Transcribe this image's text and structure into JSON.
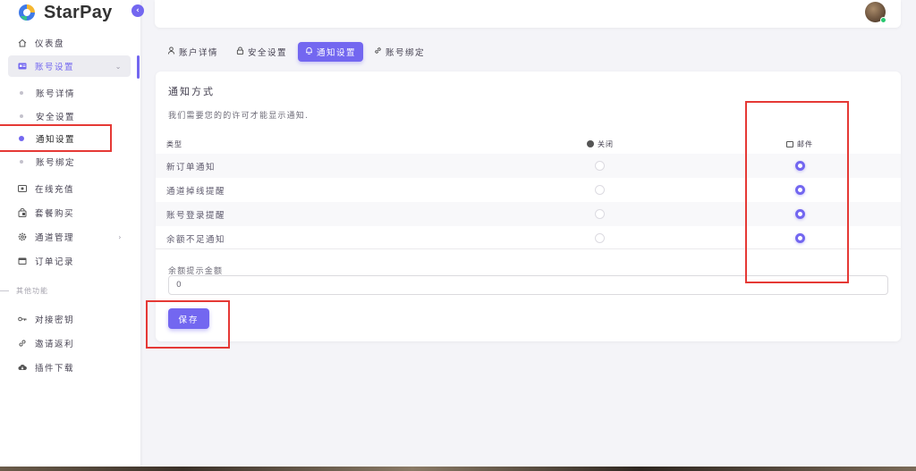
{
  "brand": {
    "name": "StarPay"
  },
  "colors": {
    "accent": "#7367f0",
    "annotation": "#e53935"
  },
  "sidebar": {
    "items": [
      {
        "label": "仪表盘",
        "icon": "home-icon"
      },
      {
        "label": "账号设置",
        "icon": "id-card-icon"
      },
      {
        "label": "在线充值",
        "icon": "wallet-icon"
      },
      {
        "label": "套餐购买",
        "icon": "shopping-bag-icon"
      },
      {
        "label": "通道管理",
        "icon": "gear-icon"
      },
      {
        "label": "订单记录",
        "icon": "calendar-icon"
      }
    ],
    "sub_items": [
      {
        "label": "账号详情"
      },
      {
        "label": "安全设置"
      },
      {
        "label": "通知设置"
      },
      {
        "label": "账号绑定"
      }
    ],
    "section_title": "其他功能",
    "other_items": [
      {
        "label": "对接密钥",
        "icon": "key-icon"
      },
      {
        "label": "邀请返利",
        "icon": "link-icon"
      },
      {
        "label": "插件下载",
        "icon": "cloud-download-icon"
      }
    ]
  },
  "tabs": [
    {
      "label": "账户详情",
      "icon": "user-icon"
    },
    {
      "label": "安全设置",
      "icon": "lock-icon"
    },
    {
      "label": "通知设置",
      "icon": "bell-icon"
    },
    {
      "label": "账号绑定",
      "icon": "link-icon"
    }
  ],
  "card": {
    "title": "通知方式",
    "subtitle": "我们需要您的的许可才能显示通知.",
    "columns": {
      "type": "类型",
      "off": "关闭",
      "mail": "邮件"
    },
    "rows": [
      {
        "label": "新订单通知",
        "off": false,
        "mail": true
      },
      {
        "label": "通道掉线提醒",
        "off": false,
        "mail": true
      },
      {
        "label": "账号登录提醒",
        "off": false,
        "mail": true
      },
      {
        "label": "余额不足通知",
        "off": false,
        "mail": true
      }
    ],
    "amount_label": "余额提示金额",
    "amount_value": "0",
    "save_label": "保存"
  }
}
